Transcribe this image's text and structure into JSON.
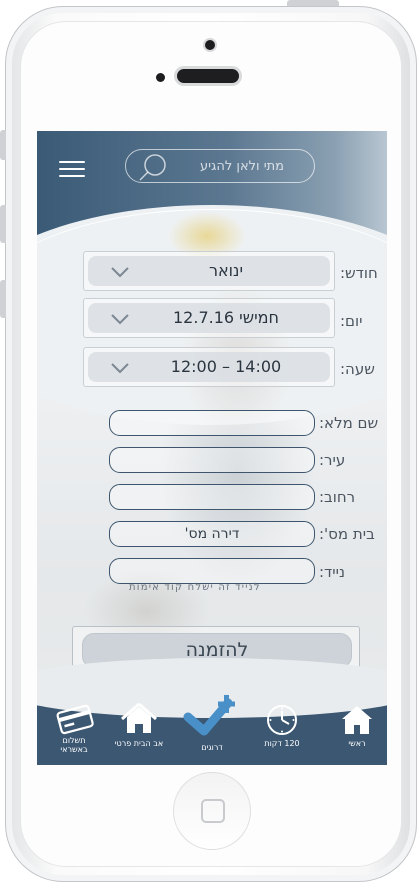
{
  "header": {
    "search_placeholder": "מתי ולאן להגיע"
  },
  "form": {
    "month": {
      "label": "חודש:",
      "value": "ינואר"
    },
    "day": {
      "label": "יום:",
      "value": "חמישי  12.7.16"
    },
    "time": {
      "label": "שעה:",
      "value": "12:00 – 14:00"
    },
    "full_name": {
      "label": "שם מלא:",
      "value": ""
    },
    "city": {
      "label": "עיר:",
      "value": ""
    },
    "street": {
      "label": "רחוב:",
      "value": ""
    },
    "house_no": {
      "label": "בית מס':",
      "value": "דירה מס'"
    },
    "mobile": {
      "label": "נייד:",
      "value": ""
    },
    "mobile_hint": "לנייד זה ישלח קוד אימות"
  },
  "order_button": "להזמנה",
  "nav": {
    "items": [
      {
        "label": "ראשי",
        "icon": "home-icon"
      },
      {
        "label": "120 דקות",
        "icon": "clock-icon"
      },
      {
        "label": "דרוגים",
        "icon": "check-plus-icon"
      },
      {
        "label": "אב הבית פרטי",
        "icon": "house-icon"
      },
      {
        "label": "תשלום באשראי",
        "icon": "credit-card-icon"
      }
    ]
  },
  "colors": {
    "brand": "#3b5772",
    "accent": "#4a90c8"
  }
}
